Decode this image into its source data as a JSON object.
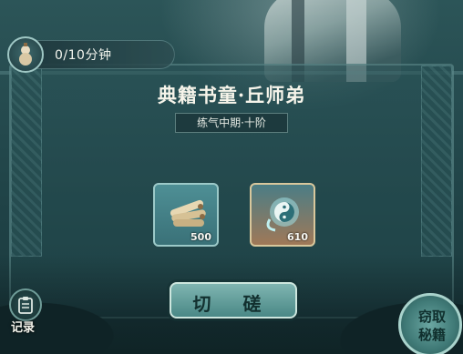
{
  "timer": {
    "text": "0/10分钟",
    "icon": "gourd-icon"
  },
  "npc": {
    "name": "典籍书童·丘师弟",
    "rank": "练气中期·十阶"
  },
  "items": [
    {
      "icon": "scroll-bundle-icon",
      "count": "500"
    },
    {
      "icon": "taiji-spirit-icon",
      "count": "610"
    }
  ],
  "actions": {
    "fight": "切 磋",
    "record": "记录",
    "steal_line1": "窃取",
    "steal_line2": "秘籍"
  },
  "colors": {
    "accent": "#9cc9c8",
    "panel": "#254b4f",
    "text": "#f6f4ea"
  }
}
